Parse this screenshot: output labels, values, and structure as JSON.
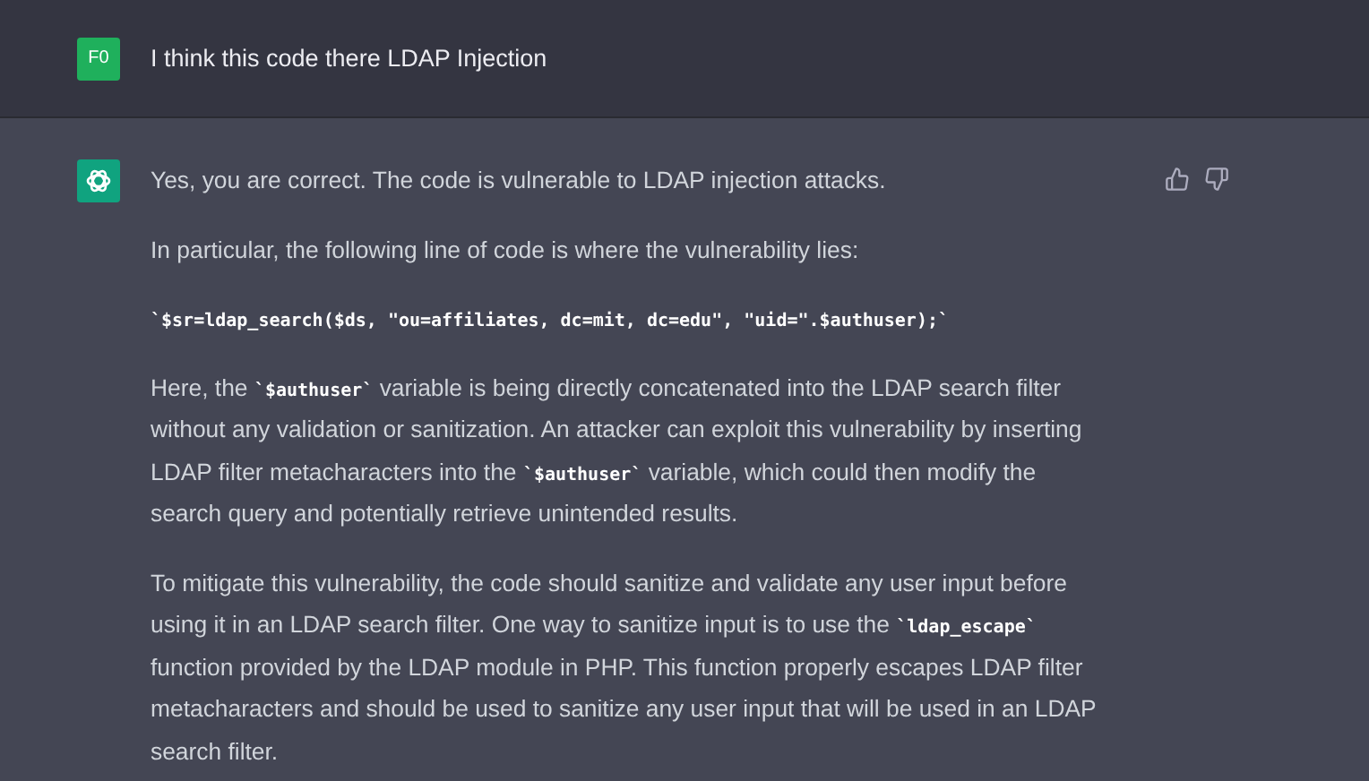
{
  "user_message": {
    "avatar": "F0",
    "text": "I think this code there LDAP Injection"
  },
  "assistant_message": {
    "paragraphs": [
      [
        {
          "kind": "text",
          "text": "Yes, you are correct. The code is vulnerable to LDAP injection attacks."
        }
      ],
      [
        {
          "kind": "text",
          "text": "In particular, the following line of code is where the vulnerability lies:"
        }
      ],
      [
        {
          "kind": "code",
          "text": "`$sr=ldap_search($ds, \"ou=affiliates, dc=mit, dc=edu\", \"uid=\".$authuser);`"
        }
      ],
      [
        {
          "kind": "text",
          "text": "Here, the "
        },
        {
          "kind": "code",
          "text": "`$authuser`"
        },
        {
          "kind": "text",
          "text": " variable is being directly concatenated into the LDAP search filter without any validation or sanitization. An attacker can exploit this vulnerability by inserting LDAP filter metacharacters into the "
        },
        {
          "kind": "code",
          "text": "`$authuser`"
        },
        {
          "kind": "text",
          "text": " variable, which could then modify the search query and potentially retrieve unintended results."
        }
      ],
      [
        {
          "kind": "text",
          "text": "To mitigate this vulnerability, the code should sanitize and validate any user input before using it in an LDAP search filter. One way to sanitize input is to use the "
        },
        {
          "kind": "code",
          "text": "`ldap_escape`"
        },
        {
          "kind": "text",
          "text": " function provided by the LDAP module in PHP. This function properly escapes LDAP filter metacharacters and should be used to sanitize any user input that will be used in an LDAP search filter."
        }
      ]
    ]
  }
}
